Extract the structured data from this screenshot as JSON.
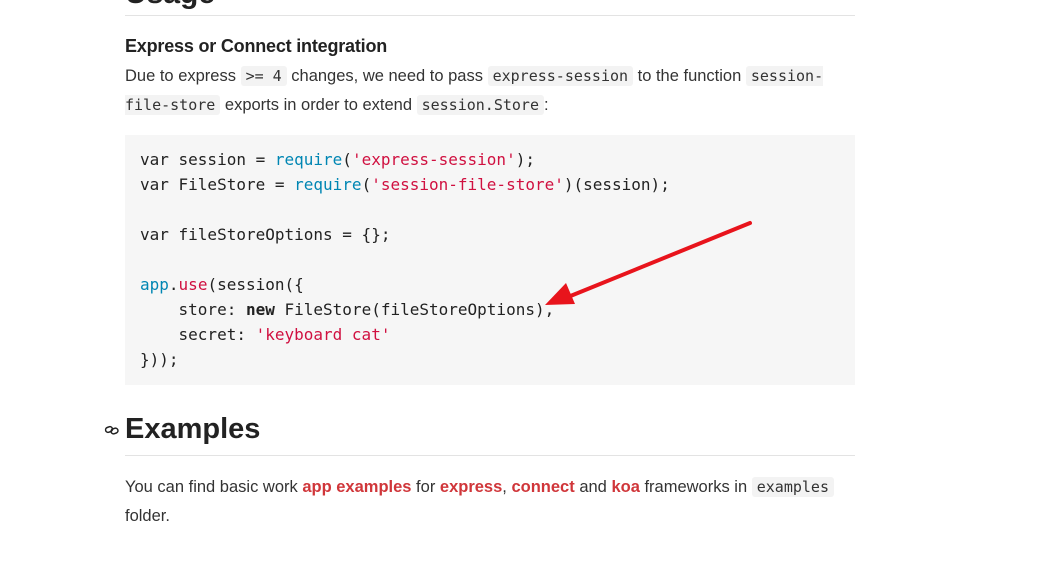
{
  "top_heading": "Usage",
  "integration": {
    "title": "Express or Connect integration",
    "text_1": "Due to express ",
    "code_1": ">= 4",
    "text_2": " changes, we need to pass ",
    "code_2": "express-session",
    "text_3": " to the function ",
    "code_3": "session-file-store",
    "text_4": " exports in order to extend ",
    "code_4": "session.Store",
    "text_5": ":"
  },
  "code": {
    "l1_var": "var session = ",
    "l1_fn": "require",
    "l1_open": "(",
    "l1_str": "'express-session'",
    "l1_close": ");",
    "l2_var": "var FileStore = ",
    "l2_fn": "require",
    "l2_open": "(",
    "l2_str": "'session-file-store'",
    "l2_close": ")(session);",
    "l4": "var fileStoreOptions = {};",
    "l6_app": "app",
    "l6_dot": ".",
    "l6_use": "use",
    "l6_rest": "(session({",
    "l7_pre": "    store: ",
    "l7_kw": "new",
    "l7_rest": " FileStore(fileStoreOptions),",
    "l8_pre": "    secret: ",
    "l8_str": "'keyboard cat'",
    "l9": "}));"
  },
  "examples": {
    "title": "Examples",
    "text_1": "You can find basic work ",
    "link_app": "app examples",
    "text_2": " for ",
    "link_express": "express",
    "text_3": ", ",
    "link_connect": "connect",
    "text_4": " and ",
    "link_koa": "koa",
    "text_5": " frameworks in ",
    "code_examples": "examples",
    "text_6": " folder."
  },
  "colors": {
    "link": "#d0363a",
    "string": "#d01040",
    "function": "#0086b3",
    "arrow": "#e8141c"
  },
  "icons": {
    "anchor": "link-icon",
    "annotation": "red-arrow"
  }
}
